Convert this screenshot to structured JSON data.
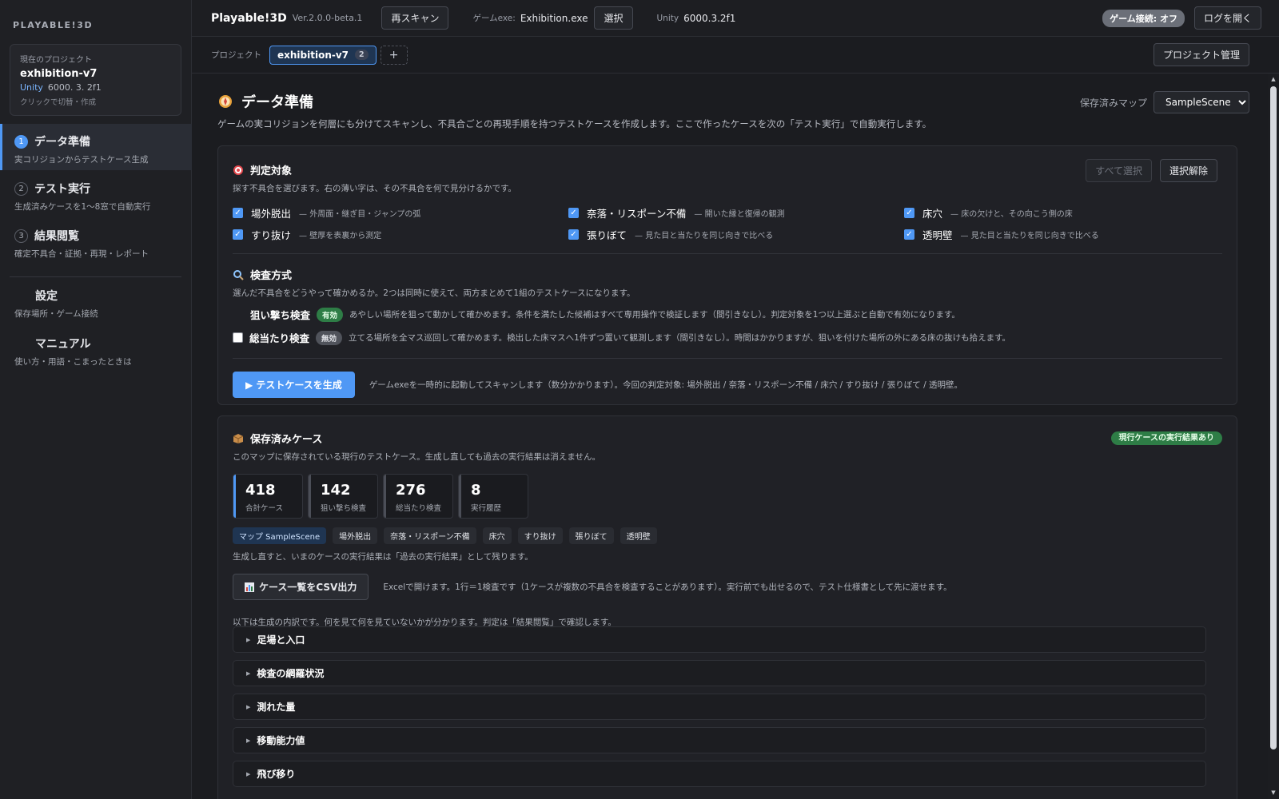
{
  "sidebar": {
    "brand": "PLAYABLE!3D",
    "project_card": {
      "label": "現在のプロジェクト",
      "name": "exhibition-v7",
      "unity_label": "Unity",
      "unity_version": "6000. 3. 2f1",
      "hint": "クリックで切替・作成"
    },
    "items": [
      {
        "num": "1",
        "label": "データ準備",
        "sub": "実コリジョンからテストケース生成",
        "active": true
      },
      {
        "num": "2",
        "label": "テスト実行",
        "sub": "生成済みケースを1〜8窓で自動実行"
      },
      {
        "num": "3",
        "label": "結果閲覧",
        "sub": "確定不具合・証拠・再現・レポート"
      },
      {
        "label": "設定",
        "sub": "保存場所・ゲーム接続"
      },
      {
        "label": "マニュアル",
        "sub": "使い方・用語・こまったときは"
      }
    ]
  },
  "header": {
    "title": "Playable!3D",
    "version": "Ver.2.0.0-beta.1",
    "rescan_label": "再スキャン",
    "game_exe_label": "ゲームexe:",
    "game_exe_value": "Exhibition.exe",
    "select_label": "選択",
    "unity_label": "Unity",
    "unity_value": "6000.3.2f1",
    "connection_status": "ゲーム接続: オフ",
    "open_log_label": "ログを開く"
  },
  "project_row": {
    "label": "プロジェクト",
    "tab_name": "exhibition-v7",
    "tab_count": "2",
    "add_label": "+",
    "manage_label": "プロジェクト管理"
  },
  "page": {
    "title": "データ準備",
    "description": "ゲームの実コリジョンを何層にも分けてスキャンし、不具合ごとの再現手順を持つテストケースを作成します。ここで作ったケースを次の「テスト実行」で自動実行します。",
    "saved_map_label": "保存済みマップ",
    "saved_map_value": "SampleScene"
  },
  "targets": {
    "title": "判定対象",
    "description": "探す不具合を選びます。右の薄い字は、その不具合を何で見分けるかです。",
    "select_all_label": "すべて選択",
    "deselect_label": "選択解除",
    "items": [
      {
        "label": "場外脱出",
        "note": "— 外周面・継ぎ目・ジャンプの弧",
        "checked": true
      },
      {
        "label": "奈落・リスポーン不備",
        "note": "— 開いた縁と復帰の観測",
        "checked": true
      },
      {
        "label": "床穴",
        "note": "— 床の欠けと、その向こう側の床",
        "checked": true
      },
      {
        "label": "すり抜け",
        "note": "— 壁厚を表裏から測定",
        "checked": true
      },
      {
        "label": "張りぼて",
        "note": "— 見た目と当たりを同じ向きで比べる",
        "checked": true
      },
      {
        "label": "透明壁",
        "note": "— 見た目と当たりを同じ向きで比べる",
        "checked": true
      }
    ]
  },
  "methods": {
    "title": "検査方式",
    "description": "選んだ不具合をどうやって確かめるか。2つは同時に使えて、両方まとめて1組のテストケースになります。",
    "items": [
      {
        "label": "狙い撃ち検査",
        "badge": "有効",
        "description": "あやしい場所を狙って動かして確かめます。条件を満たした候補はすべて専用操作で検証します（間引きなし）。判定対象を1つ以上選ぶと自動で有効になります。"
      },
      {
        "label": "総当たり検査",
        "badge": "無効",
        "description": "立てる場所を全マス巡回して確かめます。検出した床マスへ1件ずつ置いて観測します（間引きなし）。時間はかかりますが、狙いを付けた場所の外にある床の抜けも拾えます。"
      }
    ],
    "generate_label": "▶ テストケースを生成",
    "generate_note": "ゲームexeを一時的に起動してスキャンします（数分かかります）。今回の判定対象: 場外脱出 / 奈落・リスポーン不備 / 床穴 / すり抜け / 張りぼて / 透明壁。"
  },
  "saved_cases": {
    "title": "保存済みケース",
    "badge": "現行ケースの実行結果あり",
    "description": "このマップに保存されている現行のテストケース。生成し直しても過去の実行結果は消えません。",
    "stats": [
      {
        "value": "418",
        "label": "合計ケース"
      },
      {
        "value": "142",
        "label": "狙い撃ち検査"
      },
      {
        "value": "276",
        "label": "総当たり検査"
      },
      {
        "value": "8",
        "label": "実行履歴"
      }
    ],
    "chips": [
      "マップ SampleScene",
      "場外脱出",
      "奈落・リスポーン不備",
      "床穴",
      "すり抜け",
      "張りぼて",
      "透明壁"
    ],
    "regen_note": "生成し直すと、いまのケースの実行結果は「過去の実行結果」として残ります。",
    "csv_label": "ケース一覧をCSV出力",
    "csv_note": "Excelで開けます。1行＝1検査です（1ケースが複数の不具合を検査することがあります）。実行前でも出せるので、テスト仕様書として先に渡せます。",
    "breakdown_note": "以下は生成の内訳です。何を見て何を見ていないかが分かります。判定は「結果閲覧」で確認します。",
    "accordions": [
      "足場と入口",
      "検査の網羅状況",
      "測れた量",
      "移動能力値",
      "飛び移り"
    ]
  }
}
